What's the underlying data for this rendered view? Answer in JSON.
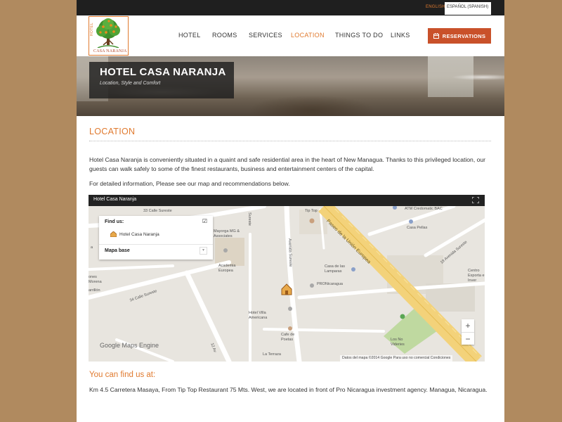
{
  "topbar": {
    "lang_english": "ENGLISH",
    "lang_spanish": "ESPAÑOL (SPANISH)"
  },
  "logo": {
    "vertical_text": "HOTEL",
    "brand": "CASA NARANJA"
  },
  "nav": {
    "items": [
      {
        "label": "HOTEL"
      },
      {
        "label": "ROOMS"
      },
      {
        "label": "SERVICES"
      },
      {
        "label": "LOCATION",
        "active": true
      },
      {
        "label": "THINGS TO DO"
      },
      {
        "label": "LINKS"
      }
    ],
    "reservations_label": "RESERVATIONS"
  },
  "hero": {
    "title": "HOTEL CASA NARANJA",
    "subtitle": "Location, Style and Comfort"
  },
  "content": {
    "section_title": "LOCATION",
    "paragraph1": "Hotel Casa Naranja is conveniently situated in a quaint and safe residential area in the heart of New Managua. Thanks to this privileged location, our guests can walk safely to some of the finest restaurants, business and entertainment centers of the capital.",
    "paragraph2": "For detailed information, Please see our map and recommendations below.",
    "find_us_title": "You can find us at:",
    "address": "Km 4.5 Carretera Masaya, From Tip Top Restaurant 75 Mts. West, we are located in front of Pro Nicaragua investment agency. Managua, Nicaragua."
  },
  "map": {
    "title": "Hotel Casa Naranja",
    "panel": {
      "find_us": "Find us:",
      "hotel_item": "Hotel Casa Naranja",
      "mapa_base": "Mapa base"
    },
    "branding": "Google Maps Engine",
    "attribution": "Datos del mapa ©2014 Google   Para uso no comercial   Condiciones",
    "zoom_in": "+",
    "zoom_out": "−",
    "labels": {
      "calle33": "33 Calle Sureste",
      "tiptop": "Tip Top",
      "atm": "ATM Credomatic BAC",
      "mayorga": "Mayorga MG & Associates",
      "casapellas": "Casa Pellas",
      "academia": "Academia Europea",
      "paseo": "Paseo de la Unión Europea",
      "avenida19": "19 Avenida Sureste",
      "avenida_sur": "Avenida Sureste",
      "lamparas": "Casa de las Lamparas",
      "pronicaragua": "PRONicaragua",
      "calle34": "34 Calle Sureste",
      "villa": "Hotel Villa Americana",
      "cafe": "Cafe de Poetas",
      "nidos": "Los No Videries",
      "terraza": "La Terraza",
      "centro": "Centro Exporta e Inver",
      "ones": "ones Morena",
      "arrillon": "arrillón",
      "frag": "a",
      "avenida12": "12 Av",
      "sureste": "Sureste"
    }
  },
  "colors": {
    "accent_orange": "#e07a2f",
    "reserve_button": "#c9512a",
    "topbar": "#1f1f1f",
    "page_background": "#b08a5f",
    "road_highlight": "#f3d27a"
  }
}
